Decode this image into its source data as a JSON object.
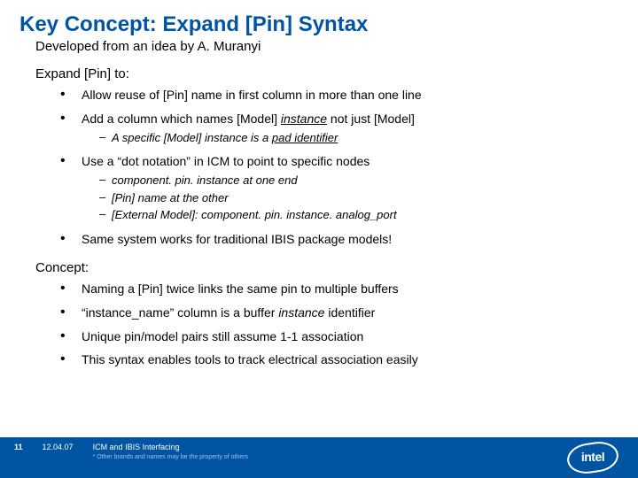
{
  "title": "Key Concept: Expand [Pin] Syntax",
  "subtitle": "Developed from an idea by A. Muranyi",
  "section1_lead": "Expand [Pin] to:",
  "s1": {
    "b1": "Allow reuse of [Pin] name in first column in more than one line",
    "b2_pre": "Add a column which names [Model] ",
    "b2_em": "instance",
    "b2_post": " not just [Model]",
    "b2_sub1_pre": "A specific [Model] instance is a ",
    "b2_sub1_em": "pad identifier",
    "b3": "Use a “dot notation” in ICM to point to specific nodes",
    "b3_sub1": "component. pin. instance at one end",
    "b3_sub2": "[Pin] name at the other",
    "b3_sub3": "[External Model]: component. pin. instance. analog_port",
    "b4": "Same system works for traditional IBIS package models!"
  },
  "section2_lead": "Concept:",
  "s2": {
    "b1": "Naming a [Pin] twice links the same pin to multiple buffers",
    "b2_pre": "“instance_name” column is a buffer ",
    "b2_em": "instance",
    "b2_post": " identifier",
    "b3": "Unique pin/model pairs still assume 1-1 association",
    "b4": "This syntax enables tools to track electrical association easily"
  },
  "footer": {
    "page": "11",
    "date": "12.04.07",
    "heading": "ICM and IBIS Interfacing",
    "disclaimer": "* Other brands and names may be the property of others"
  },
  "logo_text": "intel"
}
